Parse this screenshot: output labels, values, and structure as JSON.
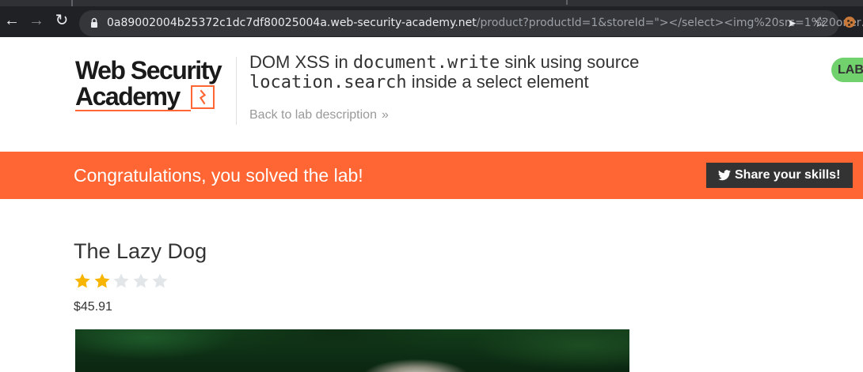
{
  "browser": {
    "url_host": "0a89002004b25372c1dc7df80025004a.web-security-academy.net",
    "url_rest": "/product?productId=1&storeId=\"></select><img%20src=1%20oner…",
    "icons": [
      "back-arrow-icon",
      "forward-arrow-icon",
      "reload-icon",
      "lock-icon",
      "send-icon",
      "star-icon",
      "extension-icon"
    ]
  },
  "logo": {
    "line1": "Web Security",
    "line2": "Academy"
  },
  "lab": {
    "title_part1": "DOM XSS in ",
    "title_code1": "document.write",
    "title_part2": " sink using source",
    "title_code2": "location.search",
    "title_part3": " inside a select element",
    "back_link": "Back to lab description",
    "status": "LAB"
  },
  "banner": {
    "message": "Congratulations, you solved the lab!",
    "share_label": "Share your skills!",
    "color": "#ff6633"
  },
  "product": {
    "title": "The Lazy Dog",
    "rating": 2,
    "rating_max": 5,
    "price": "$45.91"
  },
  "colors": {
    "accent": "#ff6633",
    "status_green": "#70d16d",
    "star_filled": "#f7b400",
    "star_empty": "#e3e6e8"
  }
}
